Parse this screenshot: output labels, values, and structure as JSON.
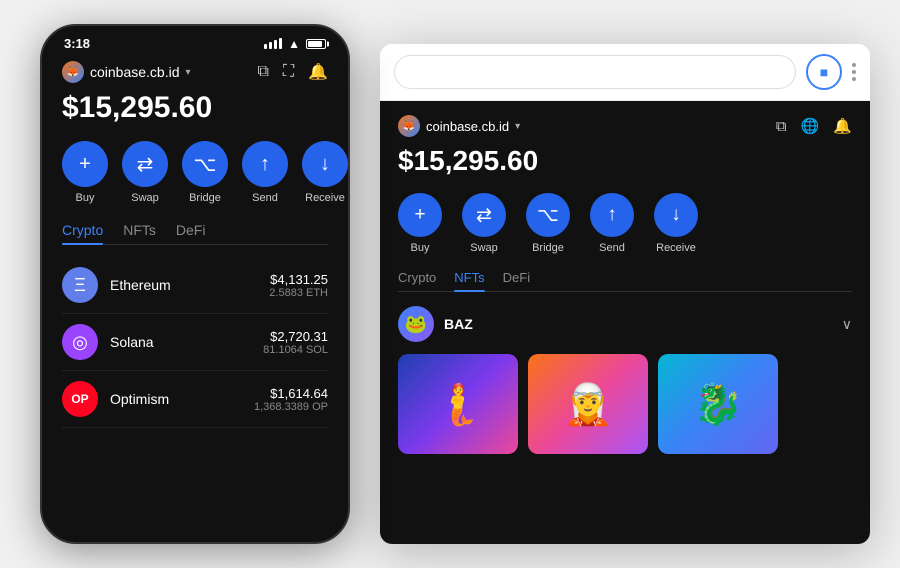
{
  "scene": {
    "background": "#f0f0f0"
  },
  "phone": {
    "status": {
      "time": "3:18"
    },
    "account": {
      "id": "coinbase.cb.id",
      "avatar_emoji": "🦊"
    },
    "balance": "$15,295.60",
    "actions": [
      {
        "label": "Buy",
        "icon": "+"
      },
      {
        "label": "Swap",
        "icon": "⇄"
      },
      {
        "label": "Bridge",
        "icon": "⌥"
      },
      {
        "label": "Send",
        "icon": "↑"
      },
      {
        "label": "Receive",
        "icon": "↓"
      }
    ],
    "tabs": [
      {
        "label": "Crypto",
        "active": true
      },
      {
        "label": "NFTs",
        "active": false
      },
      {
        "label": "DeFi",
        "active": false
      }
    ],
    "assets": [
      {
        "name": "Ethereum",
        "icon": "Ξ",
        "icon_class": "eth-icon",
        "value": "$4,131.25",
        "amount": "2.5883 ETH"
      },
      {
        "name": "Solana",
        "icon": "◎",
        "icon_class": "sol-icon",
        "value": "$2,720.31",
        "amount": "81.1064 SOL"
      },
      {
        "name": "Optimism",
        "icon": "OP",
        "icon_class": "op-icon",
        "value": "$1,614.64",
        "amount": "1,368.3389 OP"
      }
    ]
  },
  "browser": {
    "url": "",
    "account": {
      "id": "coinbase.cb.id",
      "avatar_emoji": "🦊"
    },
    "balance": "$15,295.60",
    "actions": [
      {
        "label": "Buy",
        "icon": "+"
      },
      {
        "label": "Swap",
        "icon": "⇄"
      },
      {
        "label": "Bridge",
        "icon": "⌥"
      },
      {
        "label": "Send",
        "icon": "↑"
      },
      {
        "label": "Receive",
        "icon": "↓"
      }
    ],
    "tabs": [
      {
        "label": "Crypto",
        "active": false
      },
      {
        "label": "NFTs",
        "active": true
      },
      {
        "label": "DeFi",
        "active": false
      }
    ],
    "nft_collection": {
      "name": "BAZ",
      "avatar_emoji": "🐸"
    },
    "nft_thumbnails": [
      {
        "emoji": "🧜"
      },
      {
        "emoji": "🧝"
      },
      {
        "emoji": "🐉"
      }
    ]
  }
}
